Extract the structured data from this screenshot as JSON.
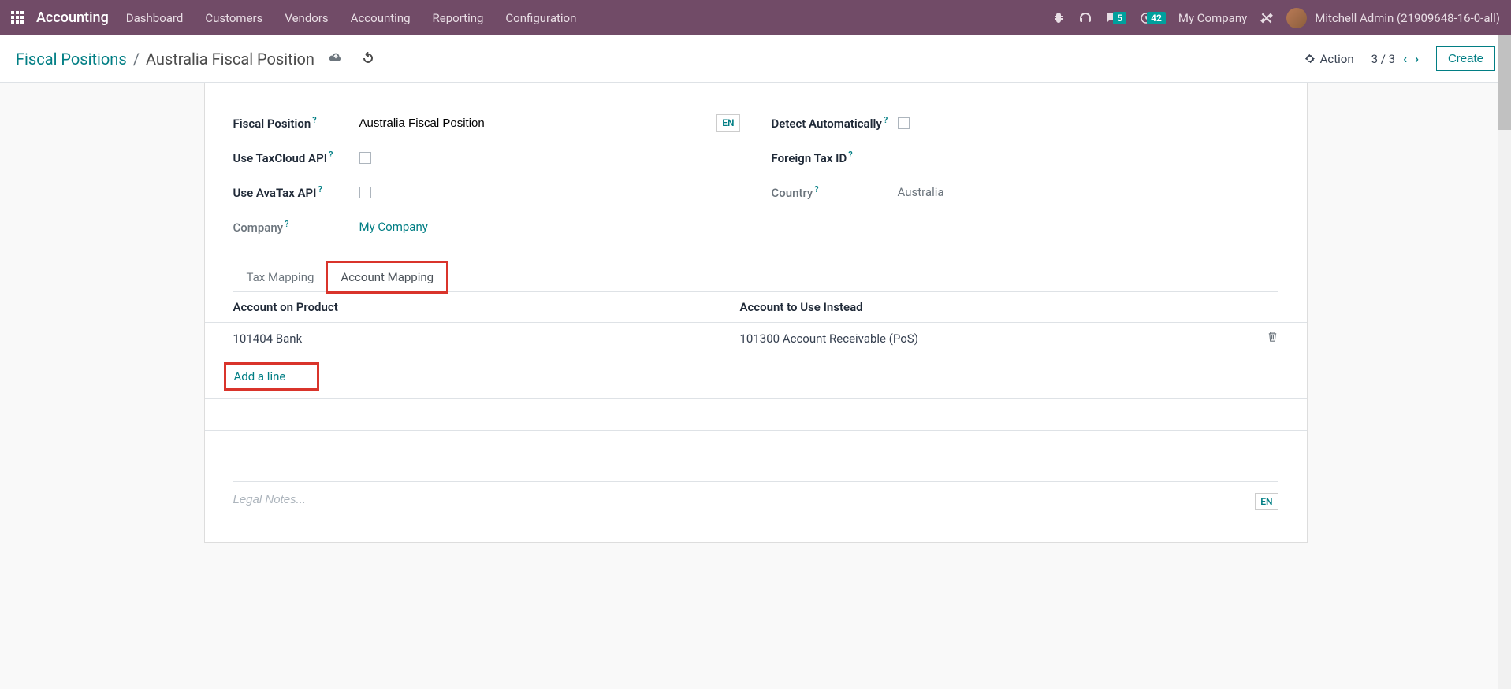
{
  "nav": {
    "brand": "Accounting",
    "menu": [
      "Dashboard",
      "Customers",
      "Vendors",
      "Accounting",
      "Reporting",
      "Configuration"
    ],
    "badges": {
      "chat": "5",
      "clock": "42"
    },
    "company": "My Company",
    "user": "Mitchell Admin (21909648-16-0-all)"
  },
  "breadcrumb": {
    "parent": "Fiscal Positions",
    "current": "Australia Fiscal Position"
  },
  "cp": {
    "action": "Action",
    "pager": "3 / 3",
    "create": "Create"
  },
  "form": {
    "fiscal_position_label": "Fiscal Position",
    "fiscal_position_value": "Australia Fiscal Position",
    "lang": "EN",
    "use_taxcloud_label": "Use TaxCloud API",
    "use_avatax_label": "Use AvaTax API",
    "company_label": "Company",
    "company_value": "My Company",
    "detect_label": "Detect Automatically",
    "foreign_tax_label": "Foreign Tax ID",
    "country_label": "Country",
    "country_value": "Australia"
  },
  "tabs": {
    "tax": "Tax Mapping",
    "account": "Account Mapping"
  },
  "table": {
    "col_a": "Account on Product",
    "col_b": "Account to Use Instead",
    "rows": [
      {
        "a": "101404 Bank",
        "b": "101300 Account Receivable (PoS)"
      }
    ],
    "add": "Add a line"
  },
  "notes": {
    "placeholder": "Legal Notes...",
    "lang": "EN"
  }
}
